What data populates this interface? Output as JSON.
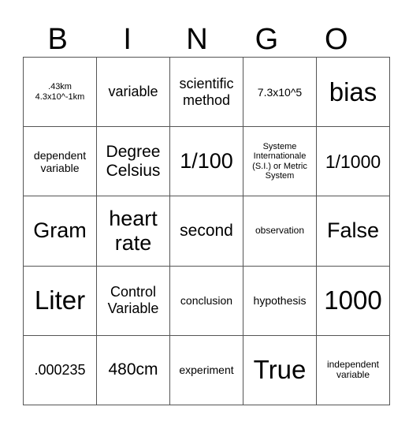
{
  "header": {
    "letters": [
      "B",
      "I",
      "N",
      "G",
      "O"
    ]
  },
  "rows": [
    [
      ".43km\n4.3x10^-1km",
      "variable",
      "scientific method",
      "7.3x10^5",
      "bias"
    ],
    [
      "dependent variable",
      "Degree Celsius",
      "1/100",
      "Systeme Internationale (S.I.) or Metric System",
      "1/1000"
    ],
    [
      "Gram",
      "heart rate",
      "second",
      "observation",
      "False"
    ],
    [
      "Liter",
      "Control Variable",
      "conclusion",
      "hypothesis",
      "1000"
    ],
    [
      ".000235",
      "480cm",
      "experiment",
      "True",
      "independent variable"
    ]
  ]
}
